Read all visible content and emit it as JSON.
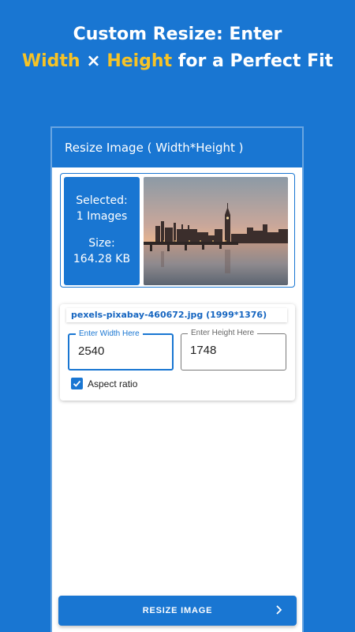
{
  "promo": {
    "line1": "Custom Resize: Enter",
    "width_word": "Width",
    "times": " × ",
    "height_word": "Height",
    "rest": " for a Perfect Fit"
  },
  "app": {
    "title": "Resize Image ( Width*Height )"
  },
  "preview": {
    "selected_label": "Selected:",
    "selected_value": "1  Images",
    "size_label": "Size:",
    "size_value": "164.28 KB"
  },
  "form": {
    "filename": "pexels-pixabay-460672.jpg  (1999*1376)",
    "width_label": "Enter Width Here",
    "width_value": "2540",
    "height_label": "Enter Height Here",
    "height_value": "1748",
    "aspect_label": "Aspect ratio",
    "aspect_checked": true
  },
  "actions": {
    "resize_label": "RESIZE IMAGE"
  },
  "colors": {
    "primary": "#1976D2",
    "highlight": "#F6C326"
  }
}
